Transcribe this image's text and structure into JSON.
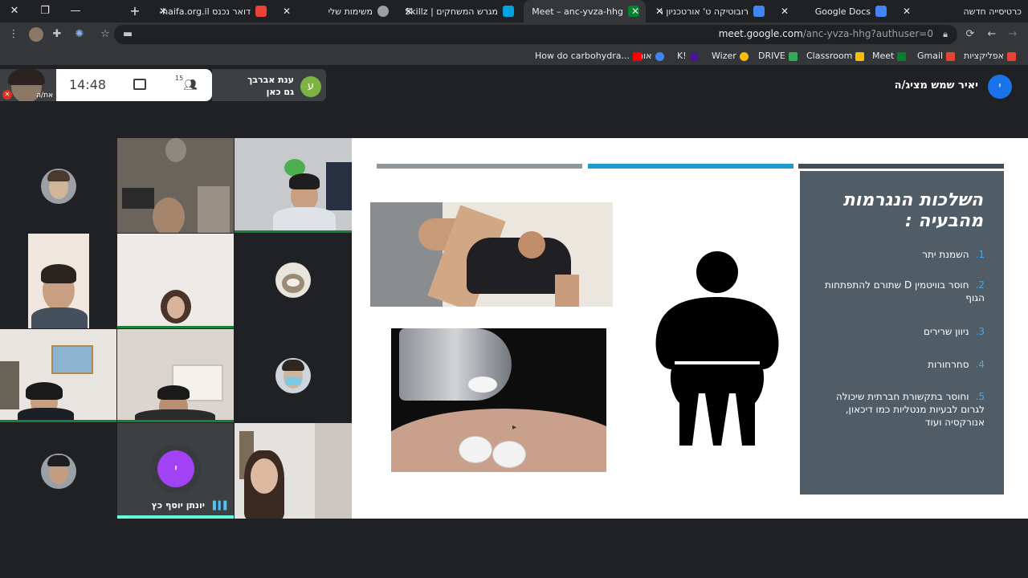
{
  "window": {
    "tabs": [
      {
        "label": "כרטיסייה חדשה",
        "favicon_color": ""
      },
      {
        "label": "Google Docs",
        "favicon_color": "#4285f4"
      },
      {
        "label": "רובוטיקה ט' אורטכניון ר",
        "favicon_color": "#4285f4"
      },
      {
        "label": "Meet – anc-yvza-hhg",
        "favicon_color": "#00832d"
      },
      {
        "label": "מגרש המשחקים | Skillz",
        "favicon_color": "#00a3e0"
      },
      {
        "label": "משימות שלי",
        "favicon_color": "#9aa0a6"
      },
      {
        "label": "דואר נכנס u-haifa.org.il",
        "favicon_color": "#ea4335"
      }
    ],
    "new_tab": "+"
  },
  "toolbar": {
    "url_host": "meet.google.com",
    "url_path": "/anc-yvza-hhg?authuser=0"
  },
  "bookmarks": [
    {
      "label": "אפליקציות",
      "color": "#ea4335"
    },
    {
      "label": "Gmail",
      "color": "#ea4335"
    },
    {
      "label": "Meet",
      "color": "#00832d"
    },
    {
      "label": "Classroom",
      "color": "#fbbc04"
    },
    {
      "label": "DRIVE",
      "color": "#34a853"
    },
    {
      "label": "Wizer",
      "color": "#fbbc04"
    },
    {
      "label": "K!",
      "color": "#46178f"
    },
    {
      "label": "אוח",
      "color": "#4285f4"
    },
    {
      "label": "How do carbohydra...",
      "color": "#ff0000"
    }
  ],
  "meet": {
    "self_name": "את/ה",
    "time": "14:48",
    "participants_count": "15",
    "joined": {
      "initial": "ע",
      "name": "ענת אברבך",
      "subtitle": "גם כאן"
    },
    "presenter": {
      "initial": "י",
      "label": "יאיר שמש מציג/ה"
    },
    "audio_tile": {
      "initial": "י",
      "name": "יונתן יוסף כץ"
    }
  },
  "slide": {
    "title": "השלכות הנגרמות מהבעיה :",
    "items": [
      {
        "num": "1.",
        "text": "השמנת יתר"
      },
      {
        "num": "2.",
        "text": "חוסר בוויטמין D שתורם להתפתחות הגוף"
      },
      {
        "num": "3.",
        "text": "ניוון שרירים"
      },
      {
        "num": "4.",
        "text": "סחרחורות"
      },
      {
        "num": "5.",
        "text": "וחוסר בתקשורת חברתית שיכולה לגרום לבעיות מנטליות כמו דיכאון, אנורקסיה ועוד"
      }
    ],
    "bar_colors": [
      "#8f969c",
      "#1f9ad6",
      "#434d56"
    ],
    "panel_color": "#505d67",
    "number_color": "#4fa3e0"
  }
}
